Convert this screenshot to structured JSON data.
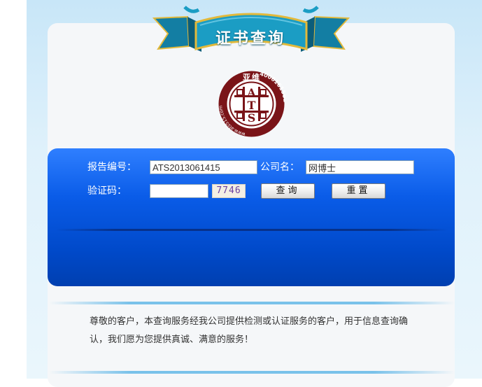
{
  "header": {
    "title": "证书查询"
  },
  "logo": {
    "top_text": "亚维",
    "center_text": "ATS",
    "right_text": "4006161582",
    "left_text": "www.ats515.com"
  },
  "form": {
    "report_no_label": "报告编号：",
    "report_no_value": "ATS2013061415",
    "company_label": "公司名：",
    "company_value": "网博士",
    "captcha_label": "验证码：",
    "captcha_value": "",
    "captcha_code": "7746",
    "query_button": "查询",
    "reset_button": "重置"
  },
  "notice": {
    "text": "尊敬的客户，本查询服务经我公司提供检测或认证服务的客户，用于信息查询确认，我们愿为您提供真诚、满意的服务！"
  },
  "colors": {
    "panel_blue": "#0a5ce8",
    "logo_red": "#7a1418",
    "ribbon_teal": "#1b9dc4",
    "ribbon_gold": "#e2b93b"
  },
  "icons": {
    "ribbon": "title-ribbon-banner",
    "logo": "ats-seal-logo"
  }
}
